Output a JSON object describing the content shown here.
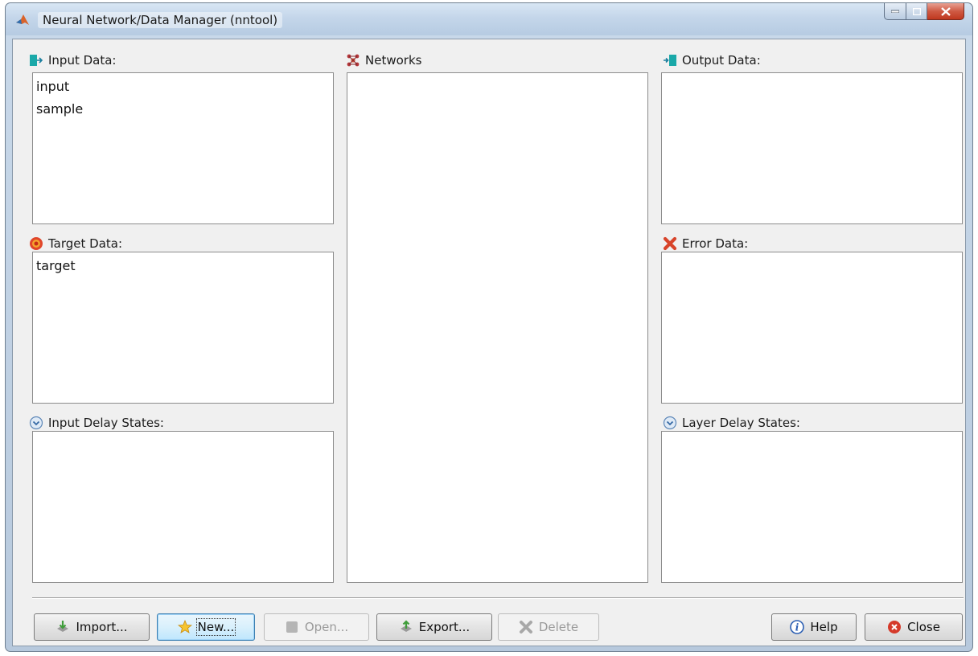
{
  "window": {
    "title": "Neural Network/Data Manager (nntool)"
  },
  "panels": {
    "input_data": {
      "label": "Input Data:",
      "items": [
        "input",
        "sample"
      ]
    },
    "target_data": {
      "label": "Target Data:",
      "items": [
        "target"
      ]
    },
    "input_delay_states": {
      "label": "Input Delay States:",
      "items": []
    },
    "networks": {
      "label": "Networks",
      "items": []
    },
    "output_data": {
      "label": "Output Data:",
      "items": []
    },
    "error_data": {
      "label": "Error Data:",
      "items": []
    },
    "layer_delay_states": {
      "label": "Layer Delay States:",
      "items": []
    }
  },
  "buttons": {
    "import": "Import...",
    "new": "New...",
    "open": "Open...",
    "export": "Export...",
    "delete": "Delete",
    "help": "Help",
    "close": "Close"
  },
  "icons": {
    "app": "matlab-logo-icon",
    "input_data": "input-arrow-icon",
    "target_data": "target-icon",
    "input_delay": "chevron-circle-icon",
    "networks": "network-icon",
    "output_data": "output-arrow-icon",
    "error_data": "error-x-icon",
    "layer_delay": "chevron-circle-icon"
  }
}
